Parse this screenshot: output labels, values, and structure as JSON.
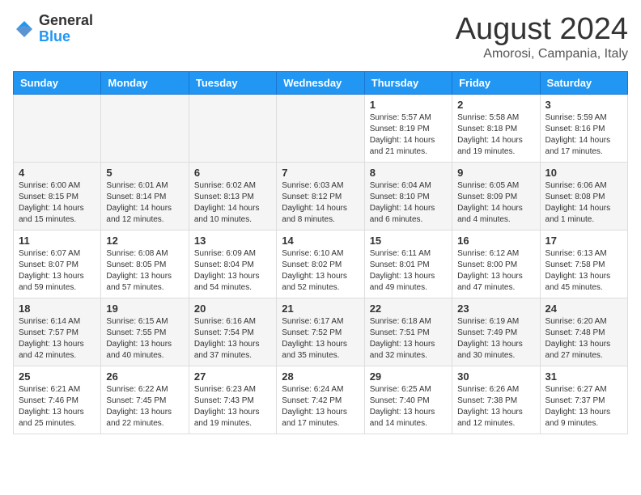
{
  "header": {
    "logo_general": "General",
    "logo_blue": "Blue",
    "month_title": "August 2024",
    "location": "Amorosi, Campania, Italy"
  },
  "weekdays": [
    "Sunday",
    "Monday",
    "Tuesday",
    "Wednesday",
    "Thursday",
    "Friday",
    "Saturday"
  ],
  "weeks": [
    [
      {
        "num": "",
        "info": ""
      },
      {
        "num": "",
        "info": ""
      },
      {
        "num": "",
        "info": ""
      },
      {
        "num": "",
        "info": ""
      },
      {
        "num": "1",
        "info": "Sunrise: 5:57 AM\nSunset: 8:19 PM\nDaylight: 14 hours\nand 21 minutes."
      },
      {
        "num": "2",
        "info": "Sunrise: 5:58 AM\nSunset: 8:18 PM\nDaylight: 14 hours\nand 19 minutes."
      },
      {
        "num": "3",
        "info": "Sunrise: 5:59 AM\nSunset: 8:16 PM\nDaylight: 14 hours\nand 17 minutes."
      }
    ],
    [
      {
        "num": "4",
        "info": "Sunrise: 6:00 AM\nSunset: 8:15 PM\nDaylight: 14 hours\nand 15 minutes."
      },
      {
        "num": "5",
        "info": "Sunrise: 6:01 AM\nSunset: 8:14 PM\nDaylight: 14 hours\nand 12 minutes."
      },
      {
        "num": "6",
        "info": "Sunrise: 6:02 AM\nSunset: 8:13 PM\nDaylight: 14 hours\nand 10 minutes."
      },
      {
        "num": "7",
        "info": "Sunrise: 6:03 AM\nSunset: 8:12 PM\nDaylight: 14 hours\nand 8 minutes."
      },
      {
        "num": "8",
        "info": "Sunrise: 6:04 AM\nSunset: 8:10 PM\nDaylight: 14 hours\nand 6 minutes."
      },
      {
        "num": "9",
        "info": "Sunrise: 6:05 AM\nSunset: 8:09 PM\nDaylight: 14 hours\nand 4 minutes."
      },
      {
        "num": "10",
        "info": "Sunrise: 6:06 AM\nSunset: 8:08 PM\nDaylight: 14 hours\nand 1 minute."
      }
    ],
    [
      {
        "num": "11",
        "info": "Sunrise: 6:07 AM\nSunset: 8:07 PM\nDaylight: 13 hours\nand 59 minutes."
      },
      {
        "num": "12",
        "info": "Sunrise: 6:08 AM\nSunset: 8:05 PM\nDaylight: 13 hours\nand 57 minutes."
      },
      {
        "num": "13",
        "info": "Sunrise: 6:09 AM\nSunset: 8:04 PM\nDaylight: 13 hours\nand 54 minutes."
      },
      {
        "num": "14",
        "info": "Sunrise: 6:10 AM\nSunset: 8:02 PM\nDaylight: 13 hours\nand 52 minutes."
      },
      {
        "num": "15",
        "info": "Sunrise: 6:11 AM\nSunset: 8:01 PM\nDaylight: 13 hours\nand 49 minutes."
      },
      {
        "num": "16",
        "info": "Sunrise: 6:12 AM\nSunset: 8:00 PM\nDaylight: 13 hours\nand 47 minutes."
      },
      {
        "num": "17",
        "info": "Sunrise: 6:13 AM\nSunset: 7:58 PM\nDaylight: 13 hours\nand 45 minutes."
      }
    ],
    [
      {
        "num": "18",
        "info": "Sunrise: 6:14 AM\nSunset: 7:57 PM\nDaylight: 13 hours\nand 42 minutes."
      },
      {
        "num": "19",
        "info": "Sunrise: 6:15 AM\nSunset: 7:55 PM\nDaylight: 13 hours\nand 40 minutes."
      },
      {
        "num": "20",
        "info": "Sunrise: 6:16 AM\nSunset: 7:54 PM\nDaylight: 13 hours\nand 37 minutes."
      },
      {
        "num": "21",
        "info": "Sunrise: 6:17 AM\nSunset: 7:52 PM\nDaylight: 13 hours\nand 35 minutes."
      },
      {
        "num": "22",
        "info": "Sunrise: 6:18 AM\nSunset: 7:51 PM\nDaylight: 13 hours\nand 32 minutes."
      },
      {
        "num": "23",
        "info": "Sunrise: 6:19 AM\nSunset: 7:49 PM\nDaylight: 13 hours\nand 30 minutes."
      },
      {
        "num": "24",
        "info": "Sunrise: 6:20 AM\nSunset: 7:48 PM\nDaylight: 13 hours\nand 27 minutes."
      }
    ],
    [
      {
        "num": "25",
        "info": "Sunrise: 6:21 AM\nSunset: 7:46 PM\nDaylight: 13 hours\nand 25 minutes."
      },
      {
        "num": "26",
        "info": "Sunrise: 6:22 AM\nSunset: 7:45 PM\nDaylight: 13 hours\nand 22 minutes."
      },
      {
        "num": "27",
        "info": "Sunrise: 6:23 AM\nSunset: 7:43 PM\nDaylight: 13 hours\nand 19 minutes."
      },
      {
        "num": "28",
        "info": "Sunrise: 6:24 AM\nSunset: 7:42 PM\nDaylight: 13 hours\nand 17 minutes."
      },
      {
        "num": "29",
        "info": "Sunrise: 6:25 AM\nSunset: 7:40 PM\nDaylight: 13 hours\nand 14 minutes."
      },
      {
        "num": "30",
        "info": "Sunrise: 6:26 AM\nSunset: 7:38 PM\nDaylight: 13 hours\nand 12 minutes."
      },
      {
        "num": "31",
        "info": "Sunrise: 6:27 AM\nSunset: 7:37 PM\nDaylight: 13 hours\nand 9 minutes."
      }
    ]
  ]
}
